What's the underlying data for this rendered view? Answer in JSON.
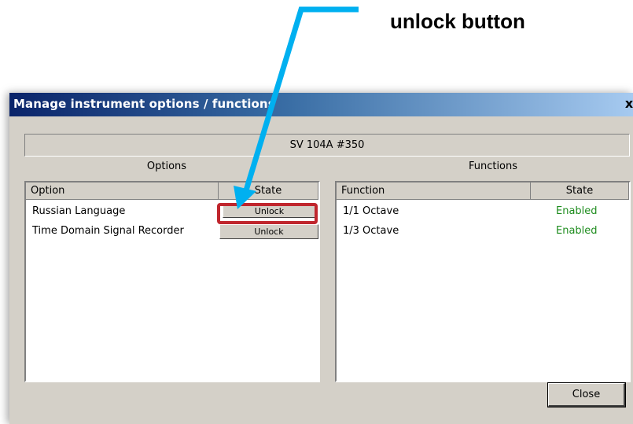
{
  "annotation": {
    "callout_text": "unlock button",
    "arrow_color": "#00b0f0",
    "highlight_color": "#c0262d"
  },
  "window": {
    "title": "Manage instrument options / functions",
    "close_glyph": "x",
    "device_label": "SV 104A #350"
  },
  "options": {
    "group_label": "Options",
    "headers": {
      "option": "Option",
      "state": "State"
    },
    "rows": [
      {
        "option": "Russian Language",
        "state_button": "Unlock"
      },
      {
        "option": "Time Domain Signal Recorder",
        "state_button": "Unlock"
      }
    ]
  },
  "functions": {
    "group_label": "Functions",
    "headers": {
      "function": "Function",
      "state": "State"
    },
    "rows": [
      {
        "function": "1/1 Octave",
        "state": "Enabled"
      },
      {
        "function": "1/3 Octave",
        "state": "Enabled"
      }
    ],
    "enabled_color": "#1e8c1e"
  },
  "footer": {
    "close_label": "Close"
  },
  "colors": {
    "dialog_bg": "#d4d0c8",
    "title_gradient_start": "#0a246a",
    "title_gradient_end": "#a6caf0"
  }
}
